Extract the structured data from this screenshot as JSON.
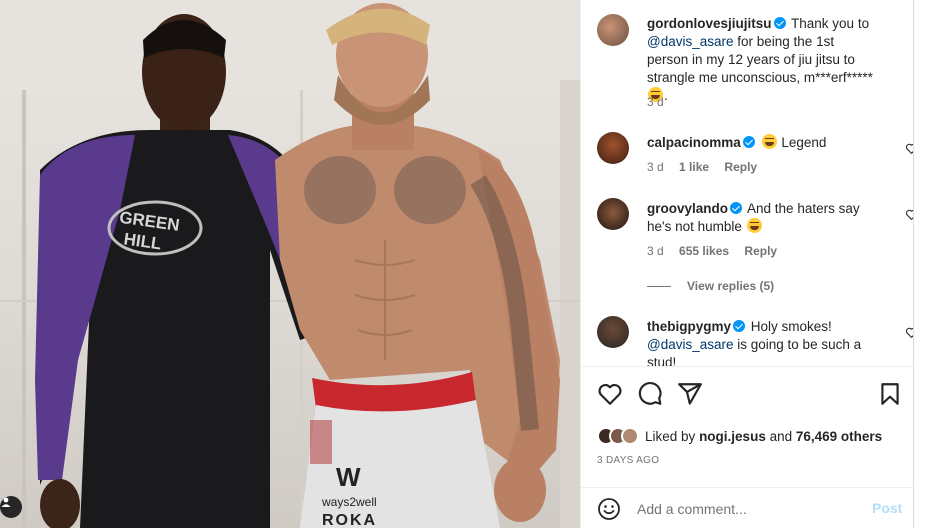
{
  "post": {
    "author": "gordonlovesjiujitsu",
    "caption_part1": "Thank you to",
    "caption_mention": "@davis_asare",
    "caption_part2": "for being the 1st person in my 12 years of jiu jitsu to strangle me unconscious, m***erf*****",
    "caption_age": "3 d",
    "photo_text": {
      "shirt_line1": "GREEN",
      "shirt_line2": "HILL",
      "shorts_logo": "W",
      "shorts_brand": "ways2well",
      "shorts_sponsor": "ROKA"
    }
  },
  "comments": [
    {
      "username": "calpacinomma",
      "text": "Legend",
      "age": "3 d",
      "likes": "1 like",
      "reply": "Reply"
    },
    {
      "username": "groovylando",
      "text": "And the haters say he's not humble",
      "age": "3 d",
      "likes": "655 likes",
      "reply": "Reply",
      "view_replies": "View replies (5)"
    },
    {
      "username": "thebigpygmy",
      "text": "Holy smokes!",
      "mention": "@davis_asare",
      "text2": "is going to be such a stud!"
    }
  ],
  "likes": {
    "prefix": "Liked by",
    "user": "nogi.jesus",
    "joiner": "and",
    "others": "76,469 others"
  },
  "date": "3 DAYS AGO",
  "add_comment": {
    "placeholder": "Add a comment...",
    "post_label": "Post"
  },
  "colors": {
    "verified": "#0095f6",
    "link": "#00376b",
    "post_disabled": "#b2dffc"
  }
}
